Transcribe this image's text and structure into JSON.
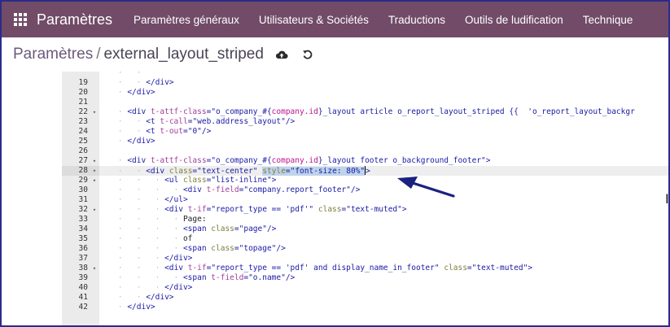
{
  "navbar": {
    "app_name": "Paramètres",
    "menu": [
      "Paramètres généraux",
      "Utilisateurs & Sociétés",
      "Traductions",
      "Outils de ludification",
      "Technique"
    ]
  },
  "breadcrumb": {
    "parent": "Paramètres",
    "separator": "/",
    "current": "external_layout_striped"
  },
  "icons": {
    "apps": "apps-grid-icon",
    "save": "cloud-upload-icon",
    "discard": "undo-icon"
  },
  "editor": {
    "lines": [
      {
        "n": "",
        "fold": false,
        "indent": 2,
        "parts": [
          [
            "tx",
            "                                        '"
          ]
        ]
      },
      {
        "n": "19",
        "fold": false,
        "indent": 2,
        "parts": [
          [
            "tag",
            "</div>"
          ]
        ]
      },
      {
        "n": "20",
        "fold": false,
        "indent": 1,
        "parts": [
          [
            "tag",
            "</div>"
          ]
        ]
      },
      {
        "n": "21",
        "fold": false,
        "indent": 0,
        "parts": []
      },
      {
        "n": "22",
        "fold": true,
        "indent": 1,
        "parts": [
          [
            "tag",
            "<div "
          ],
          [
            "attr t",
            "t-attf-class"
          ],
          [
            "tag",
            "="
          ],
          [
            "str",
            "\"o_company_#{"
          ],
          [
            "xp",
            "company.id"
          ],
          [
            "str",
            "}_layout article o_report_layout_striped {{  'o_report_layout_backgr"
          ]
        ]
      },
      {
        "n": "23",
        "fold": false,
        "indent": 2,
        "parts": [
          [
            "tag",
            "<t "
          ],
          [
            "attr t",
            "t-call"
          ],
          [
            "tag",
            "="
          ],
          [
            "str",
            "\"web.address_layout\""
          ],
          [
            "tag",
            "/>"
          ]
        ]
      },
      {
        "n": "24",
        "fold": false,
        "indent": 2,
        "parts": [
          [
            "tag",
            "<t "
          ],
          [
            "attr t",
            "t-out"
          ],
          [
            "tag",
            "="
          ],
          [
            "str",
            "\"0\""
          ],
          [
            "tag",
            "/>"
          ]
        ]
      },
      {
        "n": "25",
        "fold": false,
        "indent": 1,
        "parts": [
          [
            "tag",
            "</div>"
          ]
        ]
      },
      {
        "n": "26",
        "fold": false,
        "indent": 0,
        "parts": []
      },
      {
        "n": "27",
        "fold": true,
        "indent": 1,
        "parts": [
          [
            "tag",
            "<div "
          ],
          [
            "attr t",
            "t-attf-class"
          ],
          [
            "tag",
            "="
          ],
          [
            "str",
            "\"o_company_#{"
          ],
          [
            "xp",
            "company.id"
          ],
          [
            "str",
            "}_layout footer o_background_footer\""
          ],
          [
            "tag",
            ">"
          ]
        ]
      },
      {
        "n": "28",
        "fold": true,
        "indent": 2,
        "active": true,
        "parts": [
          [
            "tag",
            "<div "
          ],
          [
            "attr",
            "class"
          ],
          [
            "tag",
            "="
          ],
          [
            "str",
            "\"text-center\""
          ],
          [
            "tx",
            " "
          ],
          [
            "attr sel",
            "style"
          ],
          [
            "tag sel",
            "="
          ],
          [
            "str sel",
            "\"font-size: 80%\""
          ],
          [
            "caret",
            ""
          ],
          [
            "tag",
            ">"
          ]
        ]
      },
      {
        "n": "29",
        "fold": true,
        "indent": 3,
        "parts": [
          [
            "tag",
            "<ul "
          ],
          [
            "attr",
            "class"
          ],
          [
            "tag",
            "="
          ],
          [
            "str",
            "\"list-inline\""
          ],
          [
            "tag",
            ">"
          ]
        ]
      },
      {
        "n": "30",
        "fold": false,
        "indent": 4,
        "parts": [
          [
            "tag",
            "<div "
          ],
          [
            "attr t",
            "t-field"
          ],
          [
            "tag",
            "="
          ],
          [
            "str",
            "\"company.report_footer\""
          ],
          [
            "tag",
            "/>"
          ]
        ]
      },
      {
        "n": "31",
        "fold": false,
        "indent": 3,
        "parts": [
          [
            "tag",
            "</ul>"
          ]
        ]
      },
      {
        "n": "32",
        "fold": true,
        "indent": 3,
        "parts": [
          [
            "tag",
            "<div "
          ],
          [
            "attr t",
            "t-if"
          ],
          [
            "tag",
            "="
          ],
          [
            "str",
            "\"report_type == 'pdf'\""
          ],
          [
            "tx",
            " "
          ],
          [
            "attr",
            "class"
          ],
          [
            "tag",
            "="
          ],
          [
            "str",
            "\"text-muted\""
          ],
          [
            "tag",
            ">"
          ]
        ]
      },
      {
        "n": "33",
        "fold": false,
        "indent": 4,
        "parts": [
          [
            "tx",
            "Page:"
          ]
        ]
      },
      {
        "n": "34",
        "fold": false,
        "indent": 4,
        "parts": [
          [
            "tag",
            "<span "
          ],
          [
            "attr",
            "class"
          ],
          [
            "tag",
            "="
          ],
          [
            "str",
            "\"page\""
          ],
          [
            "tag",
            "/>"
          ]
        ]
      },
      {
        "n": "35",
        "fold": false,
        "indent": 4,
        "parts": [
          [
            "tx",
            "of"
          ]
        ]
      },
      {
        "n": "36",
        "fold": false,
        "indent": 4,
        "parts": [
          [
            "tag",
            "<span "
          ],
          [
            "attr",
            "class"
          ],
          [
            "tag",
            "="
          ],
          [
            "str",
            "\"topage\""
          ],
          [
            "tag",
            "/>"
          ]
        ]
      },
      {
        "n": "37",
        "fold": false,
        "indent": 3,
        "parts": [
          [
            "tag",
            "</div>"
          ]
        ]
      },
      {
        "n": "38",
        "fold": true,
        "indent": 3,
        "parts": [
          [
            "tag",
            "<div "
          ],
          [
            "attr t",
            "t-if"
          ],
          [
            "tag",
            "="
          ],
          [
            "str",
            "\"report_type == 'pdf' and display_name_in_footer\""
          ],
          [
            "tx",
            " "
          ],
          [
            "attr",
            "class"
          ],
          [
            "tag",
            "="
          ],
          [
            "str",
            "\"text-muted\""
          ],
          [
            "tag",
            ">"
          ]
        ]
      },
      {
        "n": "39",
        "fold": false,
        "indent": 4,
        "parts": [
          [
            "tag",
            "<span "
          ],
          [
            "attr t",
            "t-field"
          ],
          [
            "tag",
            "="
          ],
          [
            "str",
            "\"o.name\""
          ],
          [
            "tag",
            "/>"
          ]
        ]
      },
      {
        "n": "40",
        "fold": false,
        "indent": 3,
        "parts": [
          [
            "tag",
            "</div>"
          ]
        ]
      },
      {
        "n": "41",
        "fold": false,
        "indent": 2,
        "parts": [
          [
            "tag",
            "</div>"
          ]
        ]
      },
      {
        "n": "42",
        "fold": false,
        "indent": 1,
        "parts": [
          [
            "tag",
            "</div>"
          ]
        ]
      }
    ]
  },
  "annotation": {
    "arrow_color": "#1b2180",
    "note": "arrow pointing to the selected style attribute"
  },
  "colors": {
    "navbar": "#714B67",
    "selection": "#bfd3ea"
  }
}
